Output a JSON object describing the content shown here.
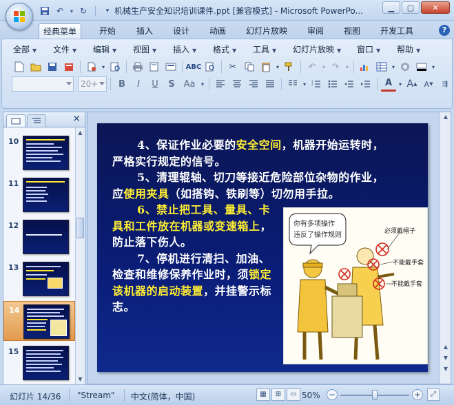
{
  "window": {
    "title": "机械生产安全知识培训课件.ppt [兼容模式] - Microsoft PowerPo...",
    "qat_icons": [
      "save-icon",
      "undo-icon",
      "redo-icon",
      "customize-icon"
    ]
  },
  "ribbon_tabs": [
    "经典菜单",
    "开始",
    "插入",
    "设计",
    "动画",
    "幻灯片放映",
    "审阅",
    "视图",
    "开发工具"
  ],
  "classic_menu": [
    "全部",
    "文件",
    "编辑",
    "视图",
    "插入",
    "格式",
    "工具",
    "幻灯片放映",
    "窗口",
    "帮助"
  ],
  "font_combo": {
    "font_value": "",
    "size_value": "20+"
  },
  "format_buttons": [
    "B",
    "I",
    "U",
    "S",
    "Aa"
  ],
  "left_pane": {
    "slides": [
      {
        "num": "10"
      },
      {
        "num": "11"
      },
      {
        "num": "12"
      },
      {
        "num": "13"
      },
      {
        "num": "14"
      },
      {
        "num": "15"
      }
    ],
    "selected": "14"
  },
  "slide": {
    "p1_a": "4、保证作业必要的",
    "p1_hl": "安全空间",
    "p1_b": "，机器开始运转时，严格实行规定的信号。",
    "p2_a": "5、清理辊轴、切刀等接近危险部位杂物的作业，应",
    "p2_hl": "使用夹具",
    "p2_b": "（如搭钩、铁刷等）切勿用手拉。",
    "p3_hl": "6、禁止把工具、量具、卡具和工件放在机器或变速箱上",
    "p3_b": "，防止落下伤人。",
    "p4_a": "7、停机进行清扫、加油、检查和维修保养作业时，须",
    "p4_hl": "锁定该机器的启动装置",
    "p4_b": "，并挂警示标志。",
    "pic_bubble": "你有多项操作违反了操作规则",
    "pic_label1": "必须戴帽子",
    "pic_label2": "不能戴手套",
    "pic_label3": "不能戴手套"
  },
  "status": {
    "slide_info": "幻灯片 14/36",
    "theme": "\"Stream\"",
    "language": "中文(简体，中国)",
    "zoom": "50%",
    "zoom_fraction": 0.5
  }
}
